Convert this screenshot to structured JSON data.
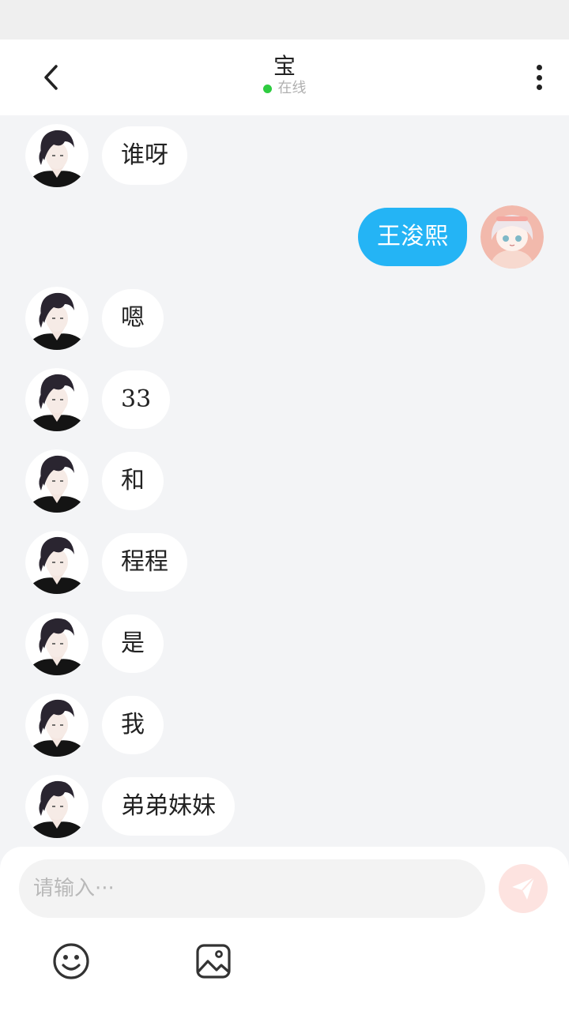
{
  "header": {
    "title": "宝",
    "status": "在线",
    "back_icon": "chevron-left-icon",
    "more_icon": "more-vertical-icon"
  },
  "messages": [
    {
      "side": "left",
      "text": "谁呀"
    },
    {
      "side": "right",
      "text": "王浚熙"
    },
    {
      "side": "left",
      "text": "嗯"
    },
    {
      "side": "left",
      "text": "33"
    },
    {
      "side": "left",
      "text": "和"
    },
    {
      "side": "left",
      "text": "程程"
    },
    {
      "side": "left",
      "text": "是"
    },
    {
      "side": "left",
      "text": "我"
    },
    {
      "side": "left",
      "text": "弟弟妹妹"
    }
  ],
  "composer": {
    "placeholder": "请输入···",
    "value": "",
    "send_icon": "send-icon",
    "tools": [
      "smiley-icon",
      "image-icon"
    ]
  },
  "colors": {
    "background": "#f3f4f6",
    "outgoing_bubble": "#24b4f5",
    "incoming_bubble": "#ffffff",
    "online": "#2ecc40",
    "send_button": "#fde3e0"
  }
}
